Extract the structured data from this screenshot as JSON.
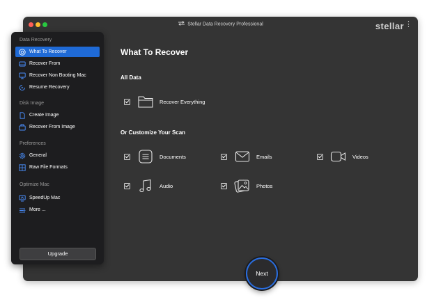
{
  "window": {
    "title": "Stellar Data Recovery Professional",
    "brand": "stellar",
    "menu_glyph": "⋮"
  },
  "sidebar": {
    "sections": [
      {
        "label": "Data Recovery"
      },
      {
        "label": "Disk Image"
      },
      {
        "label": "Preferences"
      },
      {
        "label": "Optimize Mac"
      }
    ],
    "items": [
      {
        "label": "What To Recover",
        "icon": "target-icon",
        "active": true
      },
      {
        "label": "Recover From",
        "icon": "drive-icon"
      },
      {
        "label": "Recover Non Booting Mac",
        "icon": "monitor-icon"
      },
      {
        "label": "Resume Recovery",
        "icon": "resume-icon"
      },
      {
        "label": "Create Image",
        "icon": "file-icon"
      },
      {
        "label": "Recover From Image",
        "icon": "image-drive-icon"
      },
      {
        "label": "General",
        "icon": "gear-icon"
      },
      {
        "label": "Raw File Formats",
        "icon": "grid-icon"
      },
      {
        "label": "SpeedUp Mac",
        "icon": "speedup-icon"
      },
      {
        "label": "More ...",
        "icon": "more-icon"
      }
    ],
    "upgrade_label": "Upgrade"
  },
  "main": {
    "title": "What To Recover",
    "all_data": {
      "heading": "All Data",
      "recover_everything": {
        "label": "Recover Everything",
        "checked": true,
        "icon": "folder-icon"
      }
    },
    "customize": {
      "heading": "Or Customize Your Scan",
      "options": [
        {
          "label": "Documents",
          "checked": true,
          "icon": "document-icon"
        },
        {
          "label": "Emails",
          "checked": true,
          "icon": "mail-icon"
        },
        {
          "label": "Videos",
          "checked": true,
          "icon": "video-icon"
        },
        {
          "label": "Audio",
          "checked": true,
          "icon": "music-icon"
        },
        {
          "label": "Photos",
          "checked": true,
          "icon": "photos-icon"
        }
      ]
    }
  },
  "footer": {
    "next_label": "Next"
  },
  "colors": {
    "accent": "#1f6ad6",
    "window_bg": "#343434",
    "sidebar_bg": "#1d1d1f"
  }
}
